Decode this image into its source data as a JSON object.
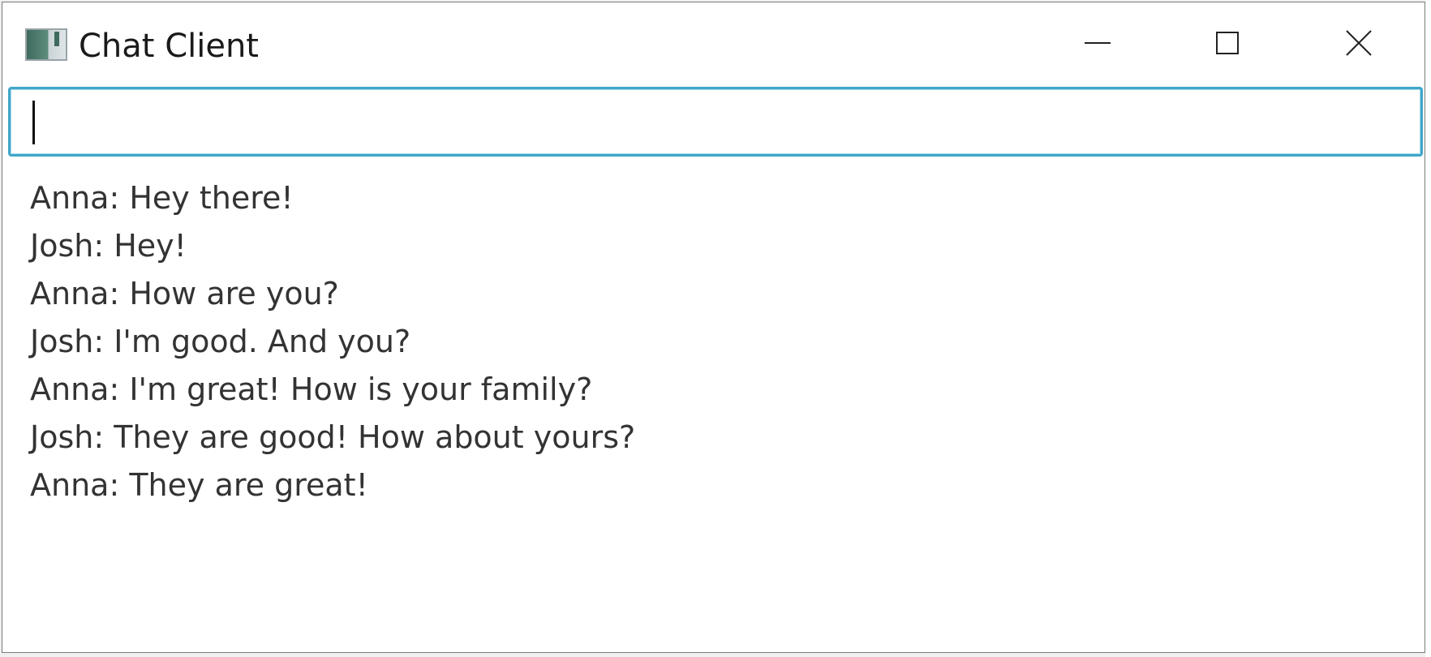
{
  "window": {
    "title": "Chat Client",
    "icon": "java-app-icon",
    "controls": {
      "minimize": "minimize-icon",
      "maximize": "maximize-icon",
      "close": "close-icon"
    }
  },
  "input": {
    "value": "",
    "placeholder": "",
    "focus_color": "#3fa6c9"
  },
  "messages": [
    "Anna: Hey there!",
    "Josh: Hey!",
    "Anna: How are you?",
    "Josh: I'm good. And you?",
    "Anna: I'm great! How is your family?",
    "Josh: They are good! How about yours?",
    "Anna: They are great!"
  ]
}
